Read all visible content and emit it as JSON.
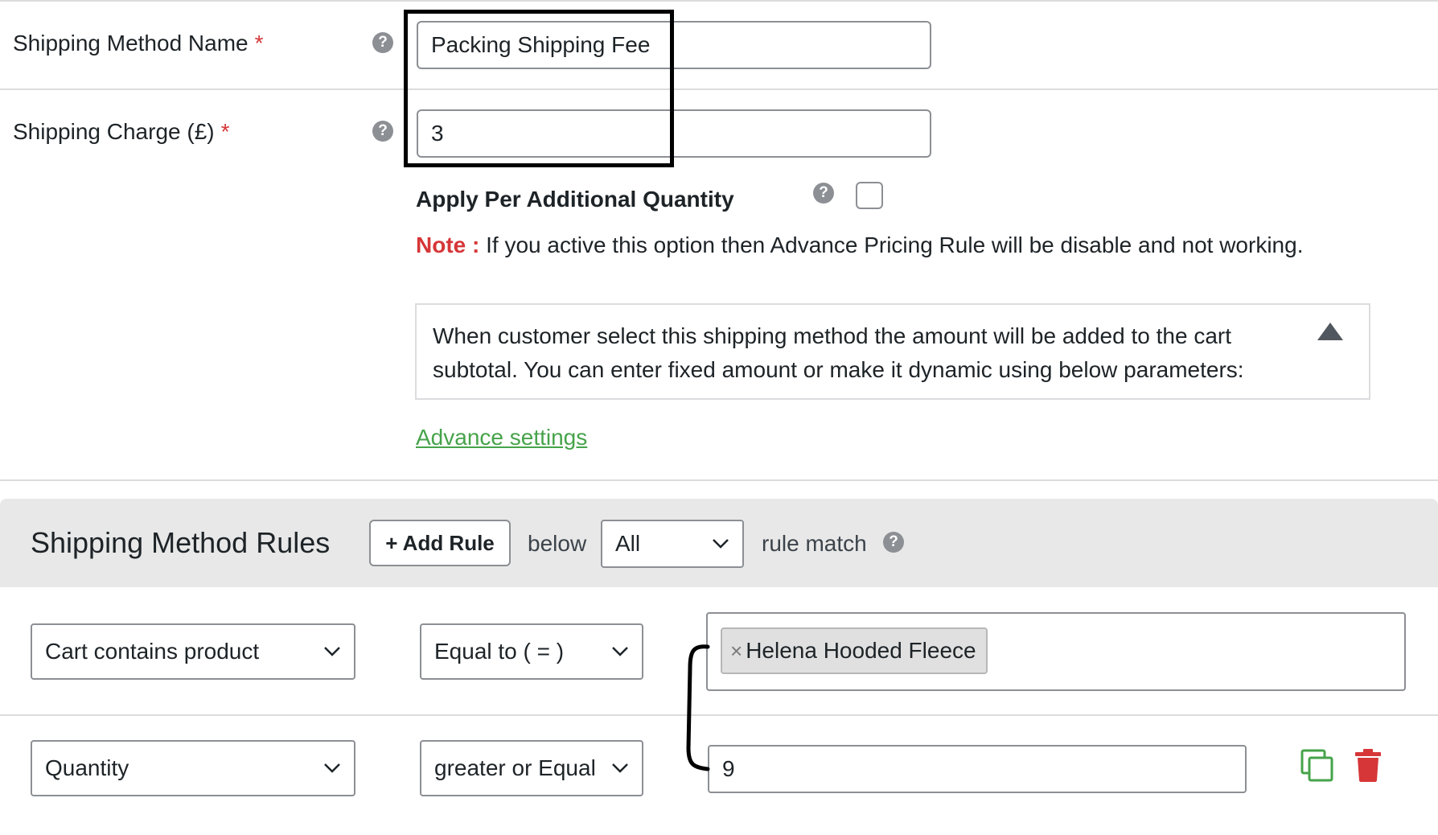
{
  "fields": {
    "method_name": {
      "label": "Shipping Method Name",
      "required_mark": "*",
      "value": "Packing Shipping Fee"
    },
    "charge": {
      "label": "Shipping Charge (£)",
      "required_mark": "*",
      "value": "3"
    }
  },
  "help_glyph": "?",
  "apply_per_qty": {
    "label": "Apply Per Additional Quantity",
    "checked": false
  },
  "note": {
    "prefix": "Note :",
    "text": "If you active this option then Advance Pricing Rule will be disable and not working."
  },
  "info": {
    "text": "When customer select this shipping method the amount will be added to the cart subtotal. You can enter fixed amount or make it dynamic using below parameters:"
  },
  "advance_settings_link": "Advance settings",
  "rules": {
    "title": "Shipping Method Rules",
    "add_button": "+ Add Rule",
    "below_text": "below",
    "match_select": "All",
    "match_text": "rule match",
    "rows": [
      {
        "condition": "Cart contains product",
        "operator": "Equal to ( = )",
        "tag": "Helena Hooded Fleece",
        "tag_remove": "×"
      },
      {
        "condition": "Quantity",
        "operator": "greater or Equal",
        "value": "9"
      }
    ]
  },
  "colors": {
    "required": "#d63638",
    "link": "#46a34a",
    "delete": "#d63638",
    "copy": "#46a34a",
    "rules_bar": "#e8e8e8"
  }
}
